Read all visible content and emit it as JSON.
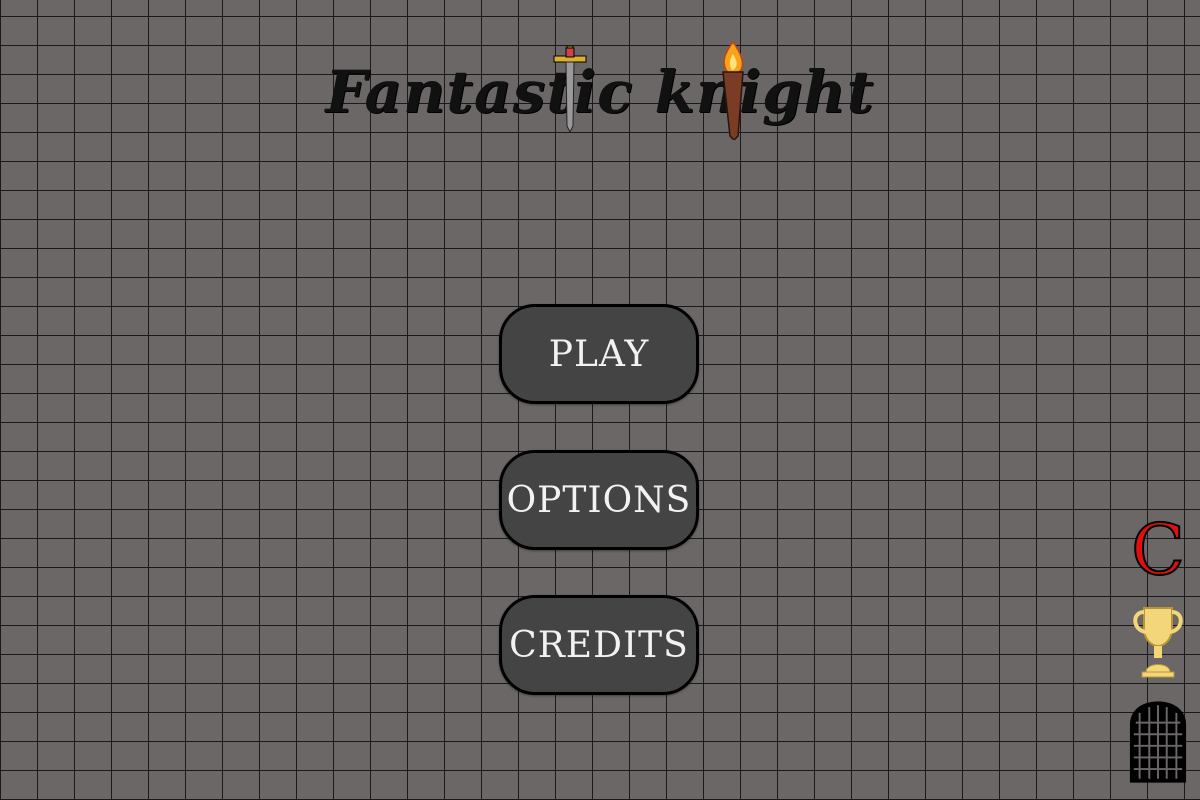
{
  "title": {
    "text": "Fantastic knight"
  },
  "menu": {
    "play_label": "PLAY",
    "options_label": "OPTIONS",
    "credits_label": "CREDITS"
  },
  "side_icons": {
    "c_label": "C",
    "c_icon": "c-letter-icon",
    "trophy_icon": "trophy-icon",
    "gate_icon": "portcullis-gate-icon"
  },
  "colors": {
    "wall": "#6b6767",
    "mortar": "#1a1a1a",
    "button_bg": "#444444",
    "button_text": "#f2f2f2",
    "c_red": "#e01010",
    "trophy_gold": "#f3d57a",
    "torch_flame": "#f7a21b"
  }
}
